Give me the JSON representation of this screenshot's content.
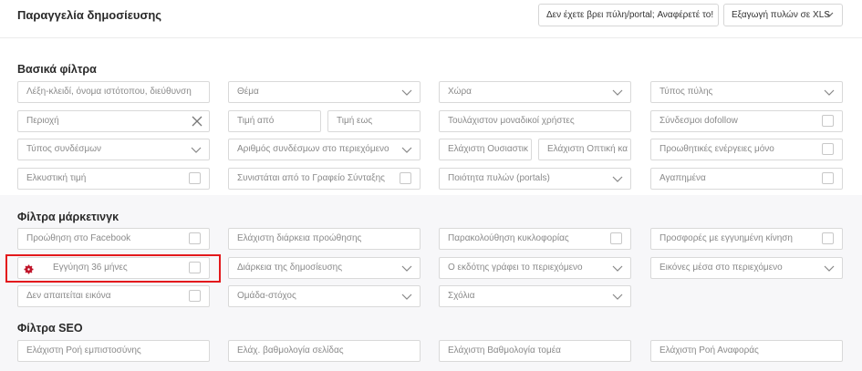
{
  "header": {
    "title": "Παραγγελία δημοσίευσης",
    "report_button": "Δεν έχετε βρει πύλη/portal; Αναφέρετέ το!",
    "export_button": "Εξαγωγή πυλών σε XLS"
  },
  "basic": {
    "title": "Βασικά φίλτρα",
    "keyword": "Λέξη-κλειδί, όνομα ιστότοπου, διεύθυνση",
    "topic": "Θέμα",
    "country": "Χώρα",
    "portal_type": "Τύπος πύλης",
    "region": "Περιοχή",
    "price_from": "Τιμή από",
    "price_to": "Τιμή εως",
    "min_unique_users": "Τουλάχιστον μοναδικοί χρήστες",
    "dofollow": "Σύνδεσμοι dofollow",
    "link_type": "Τύπος συνδέσμων",
    "link_count": "Αριθμός συνδέσμων στο περιεχόμενο",
    "min_relevance": "Ελάχιστη Ουσιαστικ",
    "min_visibility": "Ελάχιστη Οπτική κα",
    "promo_only": "Προωθητικές ενέργειες μόνο",
    "attractive_price": "Ελκυστική τιμή",
    "editorial": "Συνιστάται από το Γραφείο Σύνταξης",
    "portal_quality": "Ποιότητα πυλών (portals)",
    "favorites": "Αγαπημένα"
  },
  "marketing": {
    "title": "Φίλτρα μάρκετινγκ",
    "facebook": "Προώθηση στο Facebook",
    "min_promo_duration": "Ελάχιστη διάρκεια προώθησης",
    "traffic_tracking": "Παρακολούθηση κυκλοφορίας",
    "guaranteed_traffic": "Προσφορές με εγγυημένη κίνηση",
    "warranty": "Εγγύηση 36 μήνες",
    "pub_duration": "Διάρκεια της δημοσίευσης",
    "publisher_writes": "Ο εκδότης γράφει το περιεχόμενο",
    "images_in_content": "Εικόνες μέσα στο περιεχόμενο",
    "no_image": "Δεν απαιτείται εικόνα",
    "target_group": "Ομάδα-στόχος",
    "comments": "Σχόλια"
  },
  "seo": {
    "title": "Φίλτρα SEO",
    "trust_flow": "Ελάχιστη Ροή εμπιστοσύνης",
    "page_rating": "Ελάχ. βαθμολογία σελίδας",
    "domain_rating": "Ελάχιστη Βαθμολογία τομέα",
    "citation_flow": "Ελάχιστη Ροή Αναφοράς"
  },
  "colors": {
    "highlight": "#e3191c",
    "badge": "#c0152a"
  }
}
